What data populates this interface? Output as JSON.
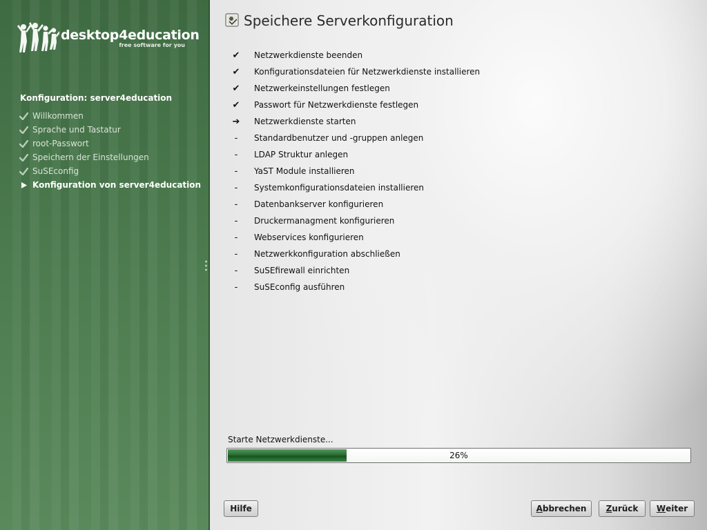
{
  "sidebar": {
    "logo": {
      "name": "desktop4education",
      "tagline": "free software for you"
    },
    "steps_title": "Konfiguration: server4education",
    "steps": [
      {
        "label": "Willkommen",
        "state": "done"
      },
      {
        "label": "Sprache und Tastatur",
        "state": "done"
      },
      {
        "label": "root-Passwort",
        "state": "done"
      },
      {
        "label": "Speichern der Einstellungen",
        "state": "done"
      },
      {
        "label": "SuSEconfig",
        "state": "done"
      },
      {
        "label": "Konfiguration von server4education",
        "state": "active"
      }
    ]
  },
  "main": {
    "title": "Speichere Serverkonfiguration",
    "tasks": [
      {
        "label": "Netzwerkdienste beenden",
        "status": "✔"
      },
      {
        "label": "Konfigurationsdateien für Netzwerkdienste installieren",
        "status": "✔"
      },
      {
        "label": "Netzwerkeinstellungen festlegen",
        "status": "✔"
      },
      {
        "label": "Passwort für Netzwerkdienste festlegen",
        "status": "✔"
      },
      {
        "label": "Netzwerkdienste starten",
        "status": "➔"
      },
      {
        "label": "Standardbenutzer und -gruppen anlegen",
        "status": "-"
      },
      {
        "label": "LDAP Struktur anlegen",
        "status": "-"
      },
      {
        "label": "YaST Module installieren",
        "status": "-"
      },
      {
        "label": "Systemkonfigurationsdateien installieren",
        "status": "-"
      },
      {
        "label": "Datenbankserver konfigurieren",
        "status": "-"
      },
      {
        "label": "Druckermanagment konfigurieren",
        "status": "-"
      },
      {
        "label": "Webservices konfigurieren",
        "status": "-"
      },
      {
        "label": "Netzwerkkonfiguration abschließen",
        "status": "-"
      },
      {
        "label": "SuSEfirewall einrichten",
        "status": "-"
      },
      {
        "label": "SuSEconfig ausführen",
        "status": "-"
      }
    ],
    "progress": {
      "label": "Starte Netzwerkdienste...",
      "percent": 26,
      "text": "26%"
    }
  },
  "buttons": {
    "help": {
      "label": "Hilfe"
    },
    "cancel": {
      "accel": "A",
      "rest": "bbrechen"
    },
    "back": {
      "accel": "Z",
      "rest": "urück"
    },
    "next": {
      "accel": "W",
      "rest": "eiter"
    }
  },
  "colors": {
    "sidebar_green": "#4b7a4e",
    "progress_green": "#1f6b2c",
    "check_gray": "#b9cdb9"
  },
  "icons": {
    "step_done": "check-icon",
    "step_active": "triangle-right-icon",
    "title": "config-save-icon"
  }
}
